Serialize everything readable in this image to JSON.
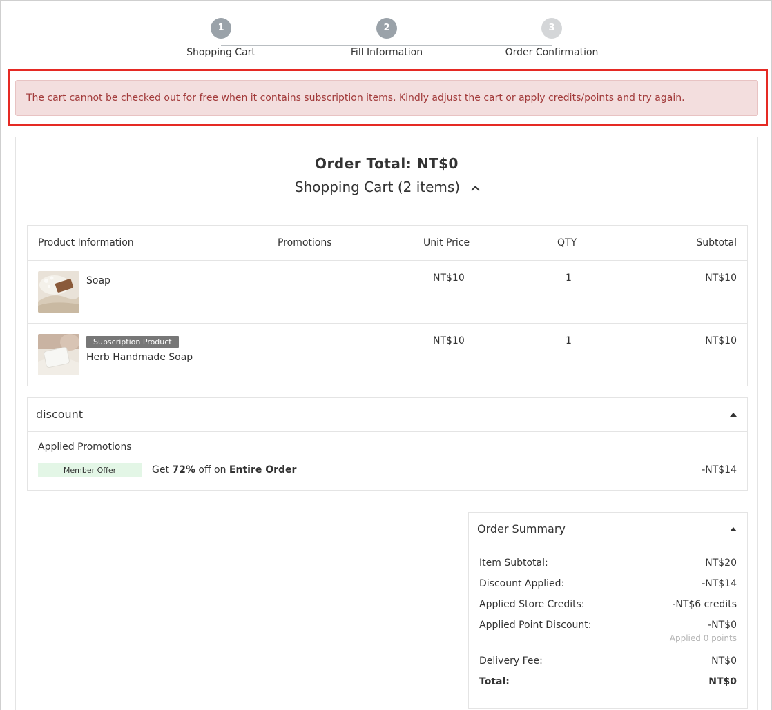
{
  "stepper": {
    "steps": [
      {
        "number": "1",
        "label": "Shopping Cart"
      },
      {
        "number": "2",
        "label": "Fill Information"
      },
      {
        "number": "3",
        "label": "Order Confirmation"
      }
    ]
  },
  "alert": {
    "message": "The cart cannot be checked out for free when it contains subscription items. Kindly adjust the cart or apply credits/points and try again."
  },
  "order": {
    "total_label": "Order Total: NT$0",
    "cart_title": "Shopping Cart (2 items)"
  },
  "cart_table": {
    "headers": {
      "product": "Product Information",
      "promotions": "Promotions",
      "unit_price": "Unit Price",
      "qty": "QTY",
      "subtotal": "Subtotal"
    },
    "rows": [
      {
        "name": "Soap",
        "tag": "",
        "unit_price": "NT$10",
        "qty": "1",
        "subtotal": "NT$10"
      },
      {
        "name": "Herb Handmade Soap",
        "tag": "Subscription Product",
        "unit_price": "NT$10",
        "qty": "1",
        "subtotal": "NT$10"
      }
    ]
  },
  "discount": {
    "title": "discount",
    "applied_label": "Applied Promotions",
    "badge": "Member Offer",
    "text_pre": "Get ",
    "text_pct": "72%",
    "text_mid": " off on ",
    "text_scope": "Entire Order",
    "amount": "-NT$14"
  },
  "summary": {
    "title": "Order Summary",
    "item_subtotal_label": "Item Subtotal:",
    "item_subtotal_value": "NT$20",
    "discount_label": "Discount Applied:",
    "discount_value": "-NT$14",
    "credits_label": "Applied Store Credits:",
    "credits_value": "-NT$6 credits",
    "points_label": "Applied Point Discount:",
    "points_value": "-NT$0",
    "points_note": "Applied 0 points",
    "delivery_label": "Delivery Fee:",
    "delivery_value": "NT$0",
    "total_label": "Total:",
    "total_value": "NT$0"
  },
  "colors": {
    "alert_border": "#e52a24",
    "alert_bg": "#f3dede",
    "alert_text": "#a23b3b",
    "step_done": "#9aa2a9",
    "step_todo": "#d4d6d8",
    "badge_bg": "#e3f6e6",
    "tag_bg": "#777777"
  }
}
